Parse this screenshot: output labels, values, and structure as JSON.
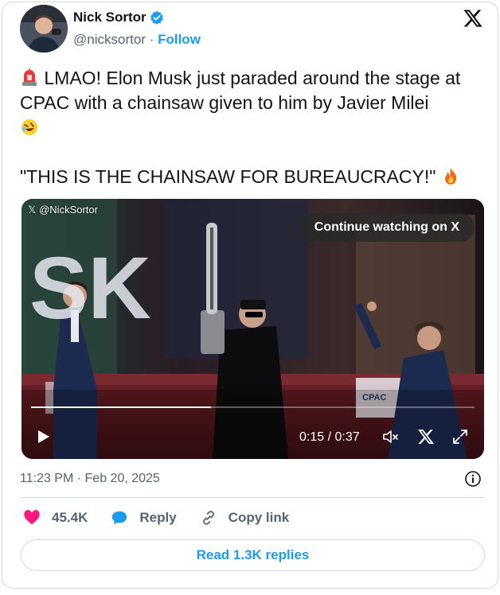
{
  "author": {
    "name": "Nick Sortor",
    "handle": "@nicksortor",
    "separator": "·",
    "follow_label": "Follow"
  },
  "tweet": {
    "line1": "LMAO! Elon Musk just paraded around the stage at CPAC with a chainsaw given to him by Javier Milei",
    "line2": "\"THIS IS THE CHAINSAW FOR BUREAUCRACY!\"",
    "emojis": [
      "siren-emoji",
      "rofl-emoji",
      "fire-emoji"
    ]
  },
  "video": {
    "watermark": "@NickSortor",
    "continue_label": "Continue watching on X",
    "time_current": "0:15",
    "time_separator": " / ",
    "time_total": "0:37",
    "progress_fraction": 0.405,
    "stage_letters": "SK",
    "cpac_logo_text": "CPAC"
  },
  "meta": {
    "time": "11:23 PM",
    "separator": "·",
    "date": "Feb 20, 2025"
  },
  "actions": {
    "likes": "45.4K",
    "reply_label": "Reply",
    "copy_label": "Copy link"
  },
  "read_replies_label": "Read 1.3K replies",
  "colors": {
    "accent": "#1d9bf0",
    "like": "#f91880",
    "muted": "#536471",
    "border": "#cfd9de"
  }
}
